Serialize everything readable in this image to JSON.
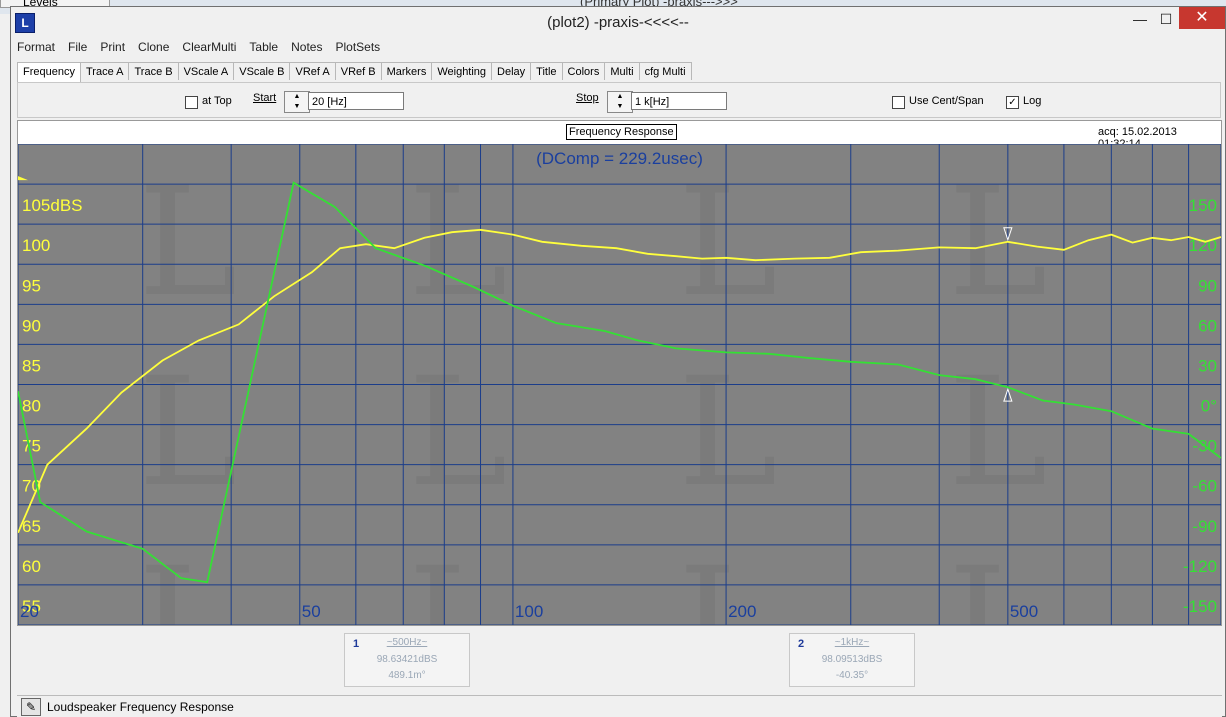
{
  "background": {
    "levels_label": "Levels",
    "primary_title": "(Primary Plot) -praxis--->>>"
  },
  "window": {
    "title": "(plot2) -praxis-<<<<--",
    "icon_letter": "L",
    "minimize": "—",
    "maximize": "☐",
    "close": "✕"
  },
  "menu": [
    "Format",
    "File",
    "Print",
    "Clone",
    "ClearMulti",
    "Table",
    "Notes",
    "PlotSets"
  ],
  "tabs": [
    "Frequency",
    "Trace A",
    "Trace B",
    "VScale A",
    "VScale B",
    "VRef A",
    "VRef B",
    "Markers",
    "Weighting",
    "Delay",
    "Title",
    "Colors",
    "Multi",
    "cfg Multi"
  ],
  "active_tab": "Frequency",
  "panel": {
    "at_top_label": "at Top",
    "at_top_checked": false,
    "start_label": "Start",
    "start_value": "20 [Hz]",
    "stop_label": "Stop",
    "stop_value": "1 k[Hz]",
    "use_cent_span_label": "Use Cent/Span",
    "use_cent_span_checked": false,
    "log_label": "Log",
    "log_checked": true
  },
  "plot": {
    "title": "Frequency Response",
    "acq": "acq: 15.02.2013 01:32:14",
    "dcomp": "(DComp = 229.2usec)",
    "background": "#828282",
    "grid_color": "#1b3d8a",
    "magnitude_color": "#ffff3c",
    "phase_color": "#34e034",
    "freq_color": "#1a3f9e"
  },
  "chart_data": {
    "type": "line",
    "title": "Frequency Response",
    "xscale": "log",
    "xlim": [
      20,
      1000
    ],
    "x_ticks": [
      20,
      50,
      100,
      200,
      500
    ],
    "x_tick_labels": [
      "20",
      "50",
      "100",
      "200",
      "500"
    ],
    "y_left": {
      "ylim": [
        52.5,
        112.5
      ],
      "ticks": [
        55,
        60,
        65,
        70,
        75,
        80,
        85,
        90,
        95,
        100,
        105
      ],
      "tick_labels": [
        "55",
        "60",
        "65",
        "70",
        "75",
        "80",
        "85",
        "90",
        "95",
        "100",
        "105dBS"
      ]
    },
    "y_right": {
      "ylim": [
        -165,
        195
      ],
      "ticks": [
        -150,
        -120,
        -90,
        -60,
        -30,
        0,
        30,
        60,
        90,
        120,
        150
      ],
      "tick_labels": [
        "-150",
        "-120",
        "-90",
        "-60",
        "-30",
        "0°",
        "30",
        "60",
        "90",
        "120",
        "150"
      ]
    },
    "series": [
      {
        "axis": "left",
        "points": [
          [
            20,
            64
          ],
          [
            22,
            72.5
          ],
          [
            25,
            77
          ],
          [
            28,
            81.5
          ],
          [
            32,
            85.5
          ],
          [
            36,
            88
          ],
          [
            41,
            90
          ],
          [
            46,
            93.5
          ],
          [
            52,
            96.5
          ],
          [
            57,
            99.5
          ],
          [
            62,
            100
          ],
          [
            68,
            99.5
          ],
          [
            75,
            100.8
          ],
          [
            82,
            101.5
          ],
          [
            90,
            101.8
          ],
          [
            100,
            101.2
          ],
          [
            110,
            100.3
          ],
          [
            125,
            99.8
          ],
          [
            140,
            99.5
          ],
          [
            155,
            98.8
          ],
          [
            170,
            98.5
          ],
          [
            185,
            98.2
          ],
          [
            200,
            98.3
          ],
          [
            220,
            98.0
          ],
          [
            250,
            98.2
          ],
          [
            280,
            98.3
          ],
          [
            310,
            99.0
          ],
          [
            350,
            99.2
          ],
          [
            400,
            99.6
          ],
          [
            450,
            99.5
          ],
          [
            500,
            100.3
          ],
          [
            550,
            99.7
          ],
          [
            600,
            99.3
          ],
          [
            650,
            100.5
          ],
          [
            700,
            101.2
          ],
          [
            750,
            100.2
          ],
          [
            800,
            100.8
          ],
          [
            850,
            100.5
          ],
          [
            900,
            100.9
          ],
          [
            950,
            100.3
          ],
          [
            1000,
            100.9
          ]
        ]
      },
      {
        "axis": "right",
        "points": [
          [
            20,
            10
          ],
          [
            21.5,
            -73
          ],
          [
            25,
            -95
          ],
          [
            30,
            -108
          ],
          [
            34,
            -130
          ],
          [
            37,
            -133
          ],
          [
            49,
            166
          ],
          [
            56,
            148
          ],
          [
            64,
            117
          ],
          [
            75,
            104
          ],
          [
            88,
            88
          ],
          [
            100,
            74
          ],
          [
            115,
            61
          ],
          [
            135,
            55
          ],
          [
            150,
            48
          ],
          [
            170,
            42
          ],
          [
            200,
            39
          ],
          [
            230,
            38
          ],
          [
            260,
            35
          ],
          [
            300,
            32
          ],
          [
            350,
            30
          ],
          [
            400,
            22
          ],
          [
            450,
            19
          ],
          [
            500,
            13
          ],
          [
            560,
            3
          ],
          [
            620,
            0
          ],
          [
            700,
            -5
          ],
          [
            800,
            -18
          ],
          [
            900,
            -22
          ],
          [
            1000,
            -40
          ]
        ]
      }
    ]
  },
  "markers": [
    {
      "num": "1",
      "freq": "~500Hz~",
      "mag": "98.63421dBS",
      "phase": "489.1m°"
    },
    {
      "num": "2",
      "freq": "~1kHz~",
      "mag": "98.09513dBS",
      "phase": "-40.35°"
    }
  ],
  "status": {
    "text": "Loudspeaker Frequency Response"
  }
}
